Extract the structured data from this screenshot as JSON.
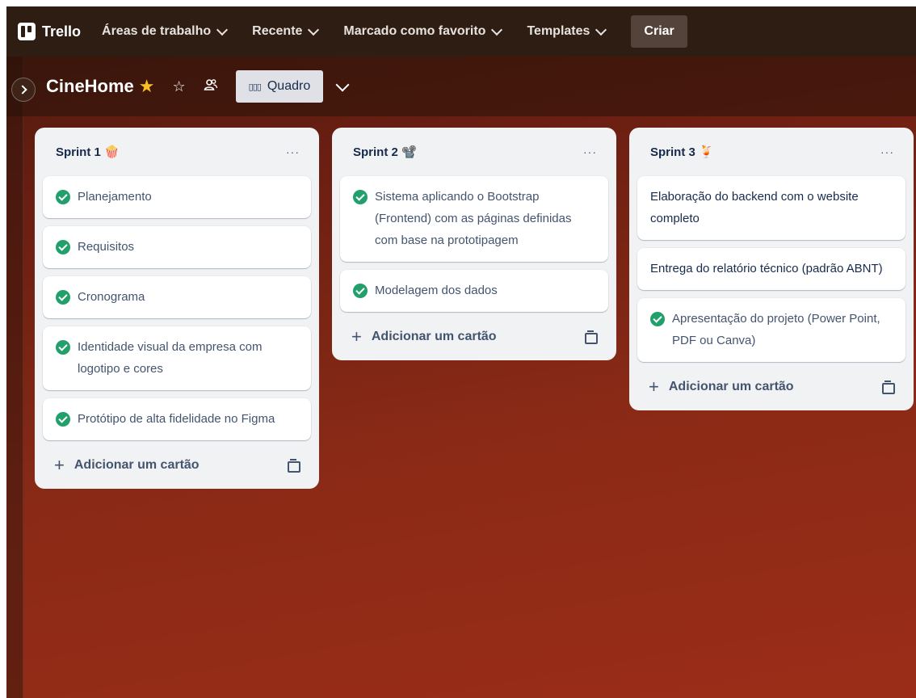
{
  "topbar": {
    "logo_text": "Trello",
    "nav": [
      {
        "label": "Áreas de trabalho"
      },
      {
        "label": "Recente"
      },
      {
        "label": "Marcado como favorito"
      },
      {
        "label": "Templates"
      }
    ],
    "create_label": "Criar"
  },
  "board": {
    "title": "CineHome",
    "star_glyph": "★",
    "favorite_glyph": "☆",
    "visibility_icon": "team-visibility-icon",
    "view_icon_glyph": "▯▯▯",
    "view_label": "Quadro"
  },
  "lists": [
    {
      "title": "Sprint 1 🍿",
      "cards": [
        {
          "text": "Planejamento",
          "done": true
        },
        {
          "text": "Requisitos",
          "done": true
        },
        {
          "text": "Cronograma",
          "done": true
        },
        {
          "text": "Identidade visual da empresa com logotipo e cores",
          "done": true
        },
        {
          "text": "Protótipo de alta fidelidade no Figma",
          "done": true
        }
      ],
      "add_label": "Adicionar um cartão"
    },
    {
      "title": "Sprint 2 📽️",
      "cards": [
        {
          "text": "Sistema aplicando o Bootstrap (Frontend) com as páginas definidas com base na prototipagem",
          "done": true
        },
        {
          "text": "Modelagem dos dados",
          "done": true
        }
      ],
      "add_label": "Adicionar um cartão"
    },
    {
      "title": "Sprint 3 🍹",
      "cards": [
        {
          "text": "Elaboração do backend com o website completo",
          "done": false
        },
        {
          "text": "Entrega do relatório técnico (padrão ABNT)",
          "done": false
        },
        {
          "text": "Apresentação do projeto (Power Point, PDF ou Canva)",
          "done": true
        }
      ],
      "add_label": "Adicionar um cartão"
    }
  ],
  "colors": {
    "topbar": "#2e1d13",
    "list_bg": "#f1f2f4",
    "check_green": "#22a06b",
    "star_gold": "#f6c026",
    "view_button": "#dfe1e6"
  }
}
